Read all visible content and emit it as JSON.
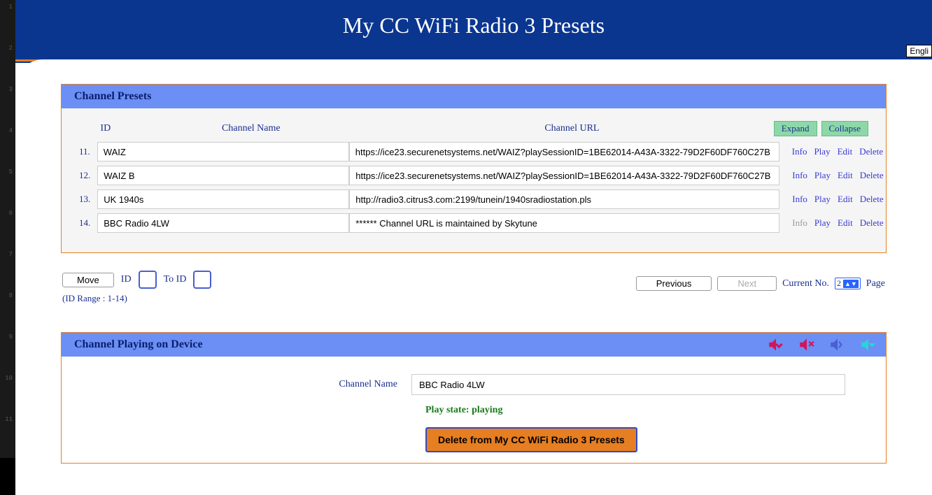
{
  "gutter": [
    "1",
    "2",
    "3",
    "4",
    "5",
    "6",
    "7",
    "8",
    "9",
    "10",
    "11"
  ],
  "header": {
    "title": "My CC WiFi Radio 3 Presets",
    "lang_btn": "Engli"
  },
  "presets": {
    "title": "Channel Presets",
    "columns": {
      "id": "ID",
      "name": "Channel Name",
      "url": "Channel URL"
    },
    "expand": "Expand",
    "collapse": "Collapse",
    "action_labels": {
      "info": "Info",
      "play": "Play",
      "edit": "Edit",
      "delete": "Delete"
    },
    "rows": [
      {
        "id": "11.",
        "name": "WAIZ",
        "url": "https://ice23.securenetsystems.net/WAIZ?playSessionID=1BE62014-A43A-3322-79D2F60DF760C27B",
        "info_enabled": true
      },
      {
        "id": "12.",
        "name": "WAIZ B",
        "url": "https://ice23.securenetsystems.net/WAIZ?playSessionID=1BE62014-A43A-3322-79D2F60DF760C27B",
        "info_enabled": true
      },
      {
        "id": "13.",
        "name": "UK 1940s",
        "url": "http://radio3.citrus3.com:2199/tunein/1940sradiostation.pls",
        "info_enabled": true
      },
      {
        "id": "14.",
        "name": "BBC Radio 4LW",
        "url": "****** Channel URL is maintained by Skytune",
        "info_enabled": false
      }
    ]
  },
  "pager": {
    "move": "Move",
    "id_label": "ID",
    "to_id_label": "To ID",
    "range": "(ID Range : 1-14)",
    "prev": "Previous",
    "next": "Next",
    "current_no": "Current No.",
    "page_num": "2",
    "page_label": "Page"
  },
  "playing": {
    "title": "Channel Playing on Device",
    "name_label": "Channel Name",
    "name_value": "BBC Radio 4LW",
    "state": "Play state: playing",
    "delete_btn": "Delete from My CC WiFi Radio 3 Presets"
  }
}
